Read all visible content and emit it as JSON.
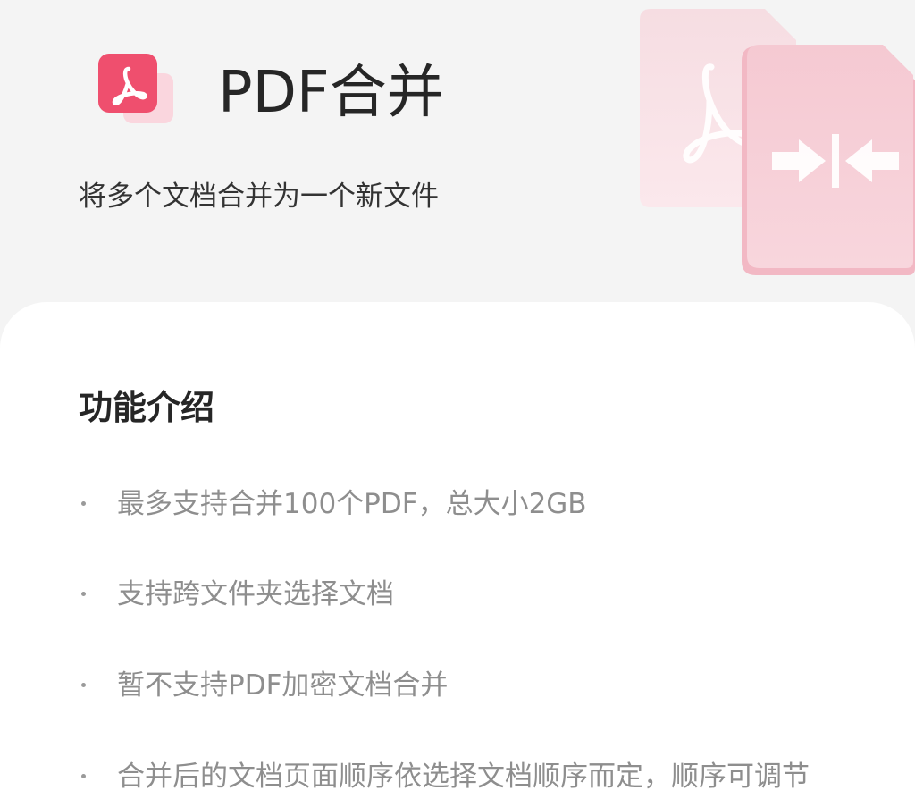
{
  "header": {
    "logo_icon": "pdf-acrobat-icon",
    "title": "PDF合并",
    "subtitle": "将多个文档合并为一个新文件",
    "illustration_icon": "pdf-merge-icon"
  },
  "intro": {
    "section_title": "功能介绍",
    "features": [
      "最多支持合并100个PDF，总大小2GB",
      "支持跨文件夹选择文档",
      "暂不支持PDF加密文档合并",
      "合并后的文档页面顺序依选择文档顺序而定，顺序可调节"
    ]
  },
  "colors": {
    "brand_red": "#f0506e",
    "light_pink": "#f9d5dd",
    "background": "#f4f4f4",
    "card": "#ffffff",
    "title_text": "#262626",
    "muted_text": "#8e8e8e"
  }
}
